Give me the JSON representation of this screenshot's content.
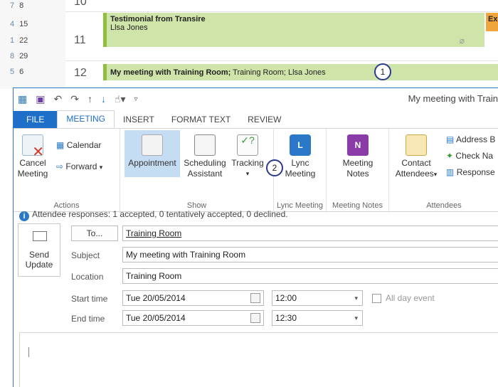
{
  "calendar": {
    "mini_rows": [
      {
        "w": "7",
        "d": "8"
      },
      {
        "w": "4",
        "d": "15"
      },
      {
        "w": "1",
        "d": "22"
      },
      {
        "w": "8",
        "d": "29"
      },
      {
        "w": "5",
        "d": "6"
      }
    ],
    "hours": [
      "10",
      "11",
      "12"
    ],
    "appt1": {
      "title": "Testimonial from Transire",
      "subtitle": "Llsa Jones"
    },
    "appt2": {
      "title": "My meeting with Training Room;",
      "subtitle": " Training Room; Llsa Jones"
    },
    "appt_orange_label": "Ex",
    "colors": {
      "appt_fill": "#cfe4a8",
      "appt_bar": "#8fbf3c",
      "orange": "#f0a63c"
    }
  },
  "callouts": [
    "1",
    "2"
  ],
  "window": {
    "title": "My meeting with Train",
    "qat_icons": [
      "calendar-icon",
      "save-icon",
      "undo-icon",
      "redo-icon",
      "up-arrow-icon",
      "down-arrow-icon",
      "touch-icon",
      "customize-icon"
    ],
    "tabs": [
      {
        "label": "FILE"
      },
      {
        "label": "MEETING"
      },
      {
        "label": "INSERT"
      },
      {
        "label": "FORMAT TEXT"
      },
      {
        "label": "REVIEW"
      }
    ],
    "accent": "#1e6fc7"
  },
  "ribbon": {
    "actions": {
      "label": "Actions",
      "cancel_line1": "Cancel",
      "cancel_line2": "Meeting",
      "calendar": "Calendar",
      "forward": "Forward"
    },
    "show": {
      "label": "Show",
      "appointment": "Appointment",
      "scheduling_line1": "Scheduling",
      "scheduling_line2": "Assistant",
      "tracking": "Tracking"
    },
    "lync": {
      "label": "Lync Meeting",
      "line1": "Lync",
      "line2": "Meeting"
    },
    "notes": {
      "label": "Meeting Notes",
      "line1": "Meeting",
      "line2": "Notes"
    },
    "attendees": {
      "label": "Attendees",
      "contact_line1": "Contact",
      "contact_line2": "Attendees",
      "address_book": "Address B",
      "check_names": "Check Na",
      "responses": "Response"
    }
  },
  "info": {
    "text": "Attendee responses: 1 accepted, 0 tentatively accepted, 0 declined."
  },
  "form": {
    "send_line1": "Send",
    "send_line2": "Update",
    "to_button": "To...",
    "to_value": "Training Room",
    "subject_label": "Subject",
    "subject_value": "My meeting with Training Room",
    "location_label": "Location",
    "location_value": "Training Room",
    "start_label": "Start time",
    "start_date": "Tue 20/05/2014",
    "start_time": "12:00",
    "end_label": "End time",
    "end_date": "Tue 20/05/2014",
    "end_time": "12:30",
    "all_day": "All day event"
  }
}
